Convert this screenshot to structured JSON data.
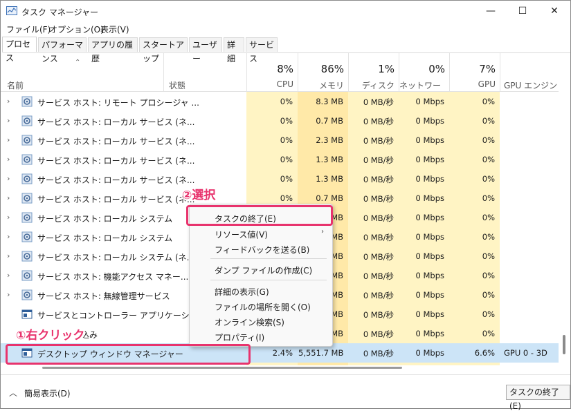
{
  "window": {
    "title": "タスク マネージャー",
    "min": "—",
    "max": "☐",
    "close": "✕"
  },
  "menu": [
    "ファイル(F)",
    "オプション(O)",
    "表示(V)"
  ],
  "tabs": [
    "プロセス",
    "パフォーマンス",
    "アプリの履歴",
    "スタートアップ",
    "ユーザー",
    "詳細",
    "サービス"
  ],
  "header": {
    "name": "名前",
    "status": "状態",
    "cpu": {
      "pct": "8%",
      "label": "CPU"
    },
    "mem": {
      "pct": "86%",
      "label": "メモリ"
    },
    "disk": {
      "pct": "1%",
      "label": "ディスク"
    },
    "net": {
      "pct": "0%",
      "label": "ネットワーク"
    },
    "gpu": {
      "pct": "7%",
      "label": "GPU"
    },
    "gpu_engine": "GPU エンジン"
  },
  "rows": [
    {
      "name": "サービス ホスト: リモート プロシージャ ...",
      "expand": true,
      "cpu": "0%",
      "mem": "8.3 MB",
      "disk": "0 MB/秒",
      "net": "0 Mbps",
      "gpu": "0%"
    },
    {
      "name": "サービス ホスト: ローカル サービス (ネ...",
      "expand": true,
      "cpu": "0%",
      "mem": "0.7 MB",
      "disk": "0 MB/秒",
      "net": "0 Mbps",
      "gpu": "0%"
    },
    {
      "name": "サービス ホスト: ローカル サービス (ネ...",
      "expand": true,
      "cpu": "0%",
      "mem": "2.3 MB",
      "disk": "0 MB/秒",
      "net": "0 Mbps",
      "gpu": "0%"
    },
    {
      "name": "サービス ホスト: ローカル サービス (ネ...",
      "expand": true,
      "cpu": "0%",
      "mem": "1.3 MB",
      "disk": "0 MB/秒",
      "net": "0 Mbps",
      "gpu": "0%"
    },
    {
      "name": "サービス ホスト: ローカル サービス (ネ...",
      "expand": true,
      "cpu": "0%",
      "mem": "1.3 MB",
      "disk": "0 MB/秒",
      "net": "0 Mbps",
      "gpu": "0%"
    },
    {
      "name": "サービス ホスト: ローカル サービス (ネ...",
      "expand": true,
      "cpu": "0%",
      "mem": "0.7 MB",
      "disk": "0 MB/秒",
      "net": "0 Mbps",
      "gpu": "0%"
    },
    {
      "name": "サービス ホスト: ローカル システム",
      "expand": true,
      "cpu": "",
      "mem": "MB",
      "disk": "0 MB/秒",
      "net": "0 Mbps",
      "gpu": "0%"
    },
    {
      "name": "サービス ホスト: ローカル システム",
      "expand": true,
      "cpu": "",
      "mem": "MB",
      "disk": "0 MB/秒",
      "net": "0 Mbps",
      "gpu": "0%"
    },
    {
      "name": "サービス ホスト: ローカル システム (ネ...",
      "expand": true,
      "cpu": "",
      "mem": "MB",
      "disk": "0 MB/秒",
      "net": "0 Mbps",
      "gpu": "0%"
    },
    {
      "name": "サービス ホスト: 機能アクセス マネー...",
      "expand": true,
      "cpu": "",
      "mem": "MB",
      "disk": "0 MB/秒",
      "net": "0 Mbps",
      "gpu": "0%"
    },
    {
      "name": "サービス ホスト: 無線管理サービス",
      "expand": true,
      "cpu": "",
      "mem": "MB",
      "disk": "0 MB/秒",
      "net": "0 Mbps",
      "gpu": "0%"
    },
    {
      "name": "サービスとコントローラー アプリケーション",
      "expand": false,
      "cpu": "",
      "mem": "MB",
      "disk": "0 MB/秒",
      "net": "0 Mbps",
      "gpu": "0%"
    },
    {
      "name": "込み",
      "expand": false,
      "cpu": "",
      "mem": "MB",
      "disk": "0 MB/秒",
      "net": "0 Mbps",
      "gpu": "0%"
    },
    {
      "name": "デスクトップ ウィンドウ マネージャー",
      "expand": false,
      "cpu": "2.4%",
      "mem": "5,551.7 MB",
      "disk": "0 MB/秒",
      "net": "0 Mbps",
      "gpu": "6.6%",
      "engine": "GPU 0 - 3D",
      "selected": true
    }
  ],
  "context_menu": [
    "タスクの終了(E)",
    "リソース値(V)",
    "フィードバックを送る(B)",
    "ダンプ ファイルの作成(C)",
    "詳細の表示(G)",
    "ファイルの場所を開く(O)",
    "オンライン検索(S)",
    "プロパティ(I)"
  ],
  "submenu_arrow": "›",
  "footer": {
    "fewer": "簡易表示(D)",
    "end_task": "タスクの終了(E)"
  },
  "annotations": {
    "step1": "①右クリック",
    "step2": "②選択",
    "highlight_color": "#e8336d"
  },
  "colors": {
    "heat_light": "#fff4c4",
    "heat_mid": "#ffe9a8",
    "selected_row": "#cce4f7"
  }
}
